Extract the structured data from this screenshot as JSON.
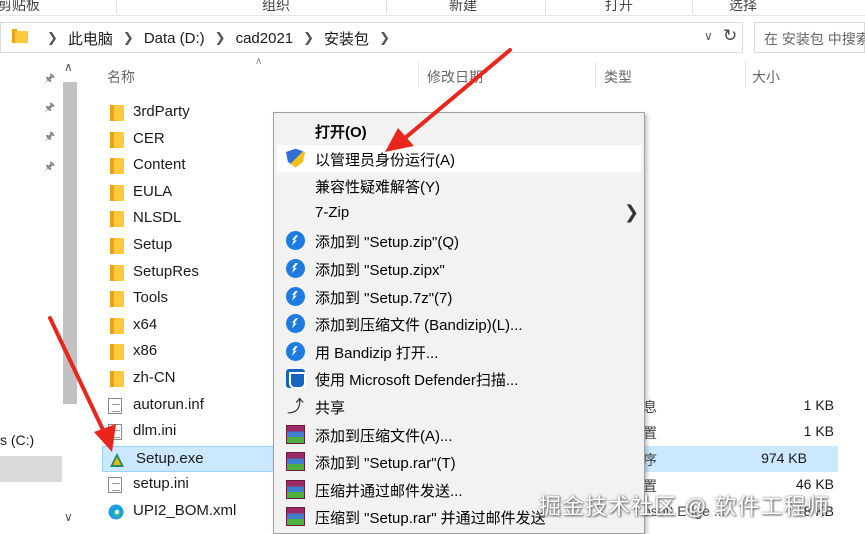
{
  "ribbon": {
    "groups": [
      "剪贴板",
      "组织",
      "新建",
      "打开",
      "选择"
    ]
  },
  "address": {
    "crumbs": [
      "此电脑",
      "Data (D:)",
      "cad2021",
      "安装包"
    ],
    "search_placeholder": "在 安装包 中搜索"
  },
  "nav": {
    "drive_label": "s (C:)"
  },
  "columns": {
    "name": "名称",
    "modified": "修改日期",
    "type": "类型",
    "size": "大小"
  },
  "files": [
    {
      "name": "3rdParty",
      "kind": "folder",
      "type": "",
      "size": ""
    },
    {
      "name": "CER",
      "kind": "folder",
      "type": "",
      "size": ""
    },
    {
      "name": "Content",
      "kind": "folder",
      "type": "",
      "size": ""
    },
    {
      "name": "EULA",
      "kind": "folder",
      "type": "",
      "size": ""
    },
    {
      "name": "NLSDL",
      "kind": "folder",
      "type": "",
      "size": ""
    },
    {
      "name": "Setup",
      "kind": "folder",
      "type": "",
      "size": ""
    },
    {
      "name": "SetupRes",
      "kind": "folder",
      "type": "",
      "size": ""
    },
    {
      "name": "Tools",
      "kind": "folder",
      "type": "",
      "size": ""
    },
    {
      "name": "x64",
      "kind": "folder",
      "type": "",
      "size": ""
    },
    {
      "name": "x86",
      "kind": "folder",
      "type": "",
      "size": ""
    },
    {
      "name": "zh-CN",
      "kind": "folder",
      "type": "",
      "size": ""
    },
    {
      "name": "autorun.inf",
      "kind": "doc",
      "type": "息",
      "size": "1 KB"
    },
    {
      "name": "dlm.ini",
      "kind": "doc",
      "type": "置",
      "size": "1 KB"
    },
    {
      "name": "Setup.exe",
      "kind": "exe",
      "type": "序",
      "size": "974 KB"
    },
    {
      "name": "setup.ini",
      "kind": "doc",
      "type": "置",
      "size": "46 KB"
    },
    {
      "name": "UPI2_BOM.xml",
      "kind": "edge",
      "type": "osoft Edge ...",
      "size": "18 KB"
    }
  ],
  "context_menu": {
    "items": [
      {
        "label": "打开(O)",
        "icon": "none"
      },
      {
        "label": "以管理员身份运行(A)",
        "icon": "uac-shield-icon"
      },
      {
        "label": "兼容性疑难解答(Y)",
        "icon": "none"
      },
      {
        "label": "7-Zip",
        "icon": "none"
      },
      {
        "label": "添加到 \"Setup.zip\"(Q)",
        "icon": "bandizip-icon"
      },
      {
        "label": "添加到 \"Setup.zipx\"",
        "icon": "bandizip-icon"
      },
      {
        "label": "添加到 \"Setup.7z\"(7)",
        "icon": "bandizip-icon"
      },
      {
        "label": "添加到压缩文件 (Bandizip)(L)...",
        "icon": "bandizip-icon"
      },
      {
        "label": "用 Bandizip 打开...",
        "icon": "bandizip-icon"
      },
      {
        "label": "使用 Microsoft Defender扫描...",
        "icon": "defender-icon"
      },
      {
        "label": "共享",
        "icon": "share-icon"
      },
      {
        "label": "添加到压缩文件(A)...",
        "icon": "winrar-icon"
      },
      {
        "label": "添加到 \"Setup.rar\"(T)",
        "icon": "winrar-icon"
      },
      {
        "label": "压缩并通过邮件发送...",
        "icon": "winrar-icon"
      },
      {
        "label": "压缩到 \"Setup.rar\" 并通过邮件发送",
        "icon": "winrar-icon"
      }
    ]
  },
  "watermark": "掘金技术社区 @ 软件工程师",
  "colors": {
    "selection": "#cce8ff",
    "arrow": "#e8261c",
    "folder": "#ffc83d"
  }
}
